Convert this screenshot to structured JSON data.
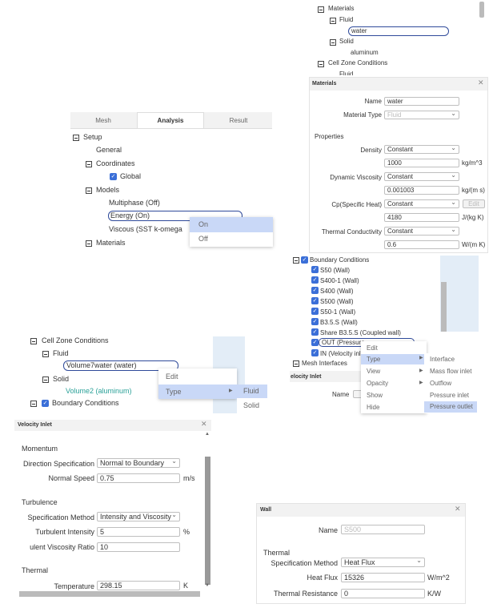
{
  "top_tree": {
    "materials": "Materials",
    "fluid": "Fluid",
    "water": "water",
    "solid": "Solid",
    "aluminum": "aluminum",
    "cell_zone_conditions": "Cell Zone Conditions",
    "fluid_cut": "Fluid"
  },
  "materials_dialog": {
    "title": "Materials",
    "name_label": "Name",
    "name_value": "water",
    "material_type_label": "Material Type",
    "material_type_value": "Fluid",
    "properties": "Properties",
    "density_label": "Density",
    "density_method": "Constant",
    "density_value": "1000",
    "density_unit": "kg/m^3",
    "viscosity_label": "Dynamic Viscosity",
    "viscosity_method": "Constant",
    "viscosity_value": "0.001003",
    "viscosity_unit": "kg/(m s)",
    "cp_label": "Cp(Specific Heat)",
    "cp_method": "Constant",
    "cp_value": "4180",
    "cp_unit": "J/(kg K)",
    "edit_label": "Edit",
    "k_label": "Thermal Conductivity",
    "k_method": "Constant",
    "k_value": "0.6",
    "k_unit": "W/(m K)"
  },
  "analysis_tree": {
    "tabs": [
      "Mesh",
      "Analysis",
      "Result"
    ],
    "setup": "Setup",
    "general": "General",
    "coordinates": "Coordinates",
    "global": "Global",
    "models": "Models",
    "multiphase": "Multiphase (Off)",
    "energy": "Energy (On)",
    "viscous": "Viscous (SST k-omega",
    "materials": "Materials",
    "menu_on": "On",
    "menu_off": "Off"
  },
  "bc_tree": {
    "root": "Boundary Conditions",
    "items": [
      "S50 (Wall)",
      "S400-1 (Wall)",
      "S400 (Wall)",
      "S500 (Wall)",
      "S50-1 (Wall)",
      "B3.5.S (Wall)",
      "Share B3.5.S (Coupled wall)",
      "OUT (Pressure",
      "IN (Velocity inl"
    ],
    "mesh_interfaces": "Mesh Interfaces",
    "menu": [
      "Edit",
      "Type",
      "View",
      "Opacity",
      "Show",
      "Hide"
    ],
    "submenu": [
      "Interface",
      "Mass flow inlet",
      "Outflow",
      "Pressure inlet",
      "Pressure outlet"
    ],
    "velocity_inlet_cut": "elocity Inlet",
    "name_cut": "Name"
  },
  "cell_zone_tree": {
    "root": "Cell Zone Conditions",
    "fluid": "Fluid",
    "volume7": "Volume7water (water)",
    "solid": "Solid",
    "volume2": "Volume2 (aluminum)",
    "bc": "Boundary Conditions",
    "menu_edit": "Edit",
    "menu_type": "Type",
    "sub_fluid": "Fluid",
    "sub_solid": "Solid"
  },
  "velocity_inlet": {
    "title": "Velocity Inlet",
    "momentum": "Momentum",
    "direction_label": "Direction Specification",
    "direction_value": "Normal to Boundary",
    "speed_label": "Normal Speed",
    "speed_value": "0.75",
    "speed_unit": "m/s",
    "turbulence": "Turbulence",
    "spec_label": "Specification Method",
    "spec_value": "Intensity and Viscosity",
    "intensity_label": "Turbulent Intensity",
    "intensity_value": "5",
    "intensity_unit": "%",
    "ratio_label": "ulent Viscosity Ratio",
    "ratio_value": "10",
    "thermal": "Thermal",
    "temp_label": "Temperature",
    "temp_value": "298.15",
    "temp_unit": "K"
  },
  "wall_dialog": {
    "title": "Wall",
    "name_label": "Name",
    "name_value": "S500",
    "thermal": "Thermal",
    "spec_label": "Specification Method",
    "spec_value": "Heat Flux",
    "flux_label": "Heat Flux",
    "flux_value": "15326",
    "flux_unit": "W/m^2",
    "resistance_label": "Thermal Resistance",
    "resistance_value": "0",
    "resistance_unit": "K/W"
  },
  "colors": {
    "accent": "#3b6fd8",
    "highlight": "#c9d8f7",
    "input_outline": "#2f4a9a",
    "teal_text": "#2aa198"
  }
}
